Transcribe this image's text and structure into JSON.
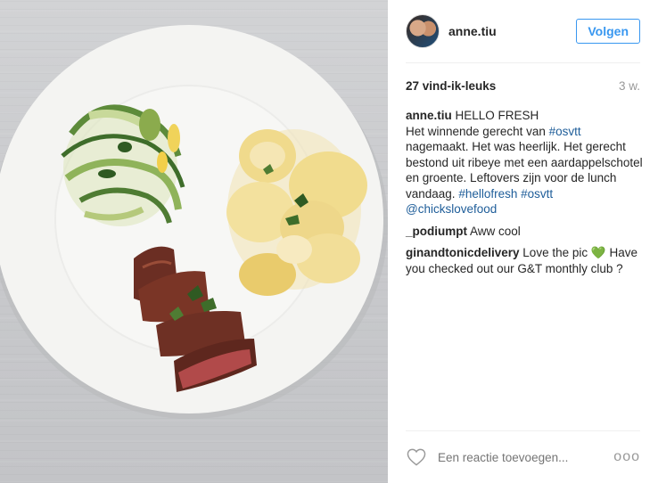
{
  "post": {
    "username": "anne.tiu",
    "follow_label": "Volgen",
    "likes_text": "27 vind-ik-leuks",
    "age": "3 w.",
    "caption": {
      "author": "anne.tiu",
      "title": "HELLO FRESH",
      "text_1": "Het winnende gerecht van",
      "hashtag_1": "#osvtt",
      "text_2": "nagemaakt. Het was heerlijk. Het gerecht bestond uit ribeye met een aardappelschotel en groente. Leftovers zijn voor de lunch vandaag.",
      "hashtag_2": "#hellofresh",
      "hashtag_3": "#osvtt",
      "mention": "@chickslovefood"
    },
    "comments": [
      {
        "author": "_podiumpt",
        "text": "Aww cool"
      },
      {
        "author": "ginandtonicdelivery",
        "text_before": "Love the pic",
        "emoji": "💚",
        "text_after": "Have you checked out our G&T monthly club ?"
      }
    ],
    "comment_placeholder": "Een reactie toevoegen...",
    "more_label": "ooo",
    "icons": {
      "like": "heart-outline-icon",
      "more": "more-options-icon"
    },
    "colors": {
      "accent": "#3897f0",
      "link": "#1e5d99",
      "muted": "#999999"
    }
  }
}
